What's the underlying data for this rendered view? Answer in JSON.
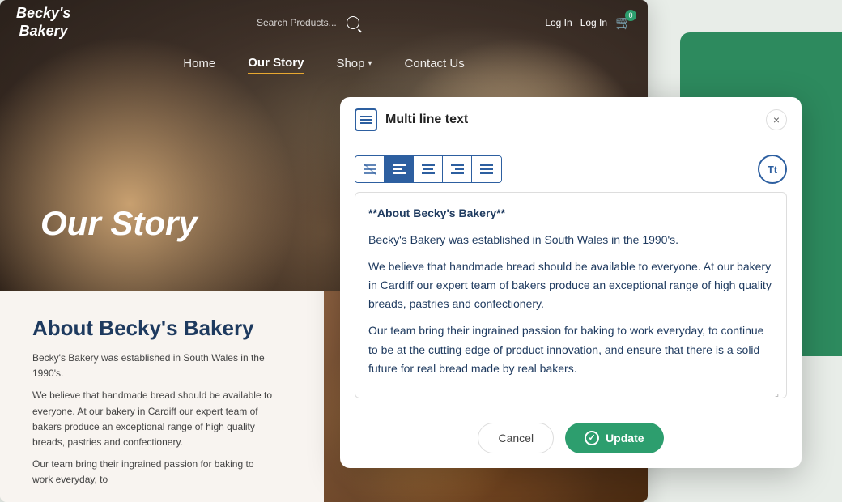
{
  "website": {
    "logo": "Becky's\nBakery",
    "search_placeholder": "Search Products...",
    "login_label": "Log In",
    "cart_count": "0",
    "nav_items": [
      {
        "label": "Home",
        "active": false
      },
      {
        "label": "Our Story",
        "active": true
      },
      {
        "label": "Shop",
        "active": false,
        "has_dropdown": true
      },
      {
        "label": "Contact Us",
        "active": false
      }
    ],
    "page_title": "Our Story",
    "content_heading": "About Becky's Bakery",
    "content_para1": "Becky's Bakery was established in South Wales in the 1990's.",
    "content_para2": "We believe that handmade bread should be available to everyone. At our bakery in Cardiff our expert team of bakers produce an exceptional range of high quality breads, pastries and confectionery.",
    "content_para3": "Our team bring their ingrained passion for baking to work everyday, to"
  },
  "modal": {
    "title": "Multi line text",
    "close_label": "×",
    "icon_label": "≡",
    "format_buttons": [
      {
        "id": "align-left-strikethrough",
        "label": "≡̶",
        "active": false
      },
      {
        "id": "align-left",
        "label": "≡",
        "active": true
      },
      {
        "id": "align-center",
        "label": "≡",
        "active": false
      },
      {
        "id": "align-right",
        "label": "≡",
        "active": false
      },
      {
        "id": "align-justify",
        "label": "≡",
        "active": false
      }
    ],
    "font-size-label": "Tt",
    "text_line1": "**About Becky's Bakery**",
    "text_line2": "Becky's Bakery was established in South Wales in the 1990's.",
    "text_line3": "We believe that handmade bread should be available to everyone. At our bakery in Cardiff our expert team of bakers produce an exceptional range of high quality breads, pastries and confectionery.",
    "text_line4": "Our team bring their ingrained passion for baking to work everyday, to continue to be at the cutting edge of product innovation, and ensure that there is a solid future for real bread made by real bakers.",
    "cancel_label": "Cancel",
    "update_label": "Update"
  },
  "colors": {
    "primary_blue": "#1e3a5f",
    "accent_orange": "#e8a830",
    "btn_green": "#2d9e6e",
    "toolbar_blue": "#2d5fa0",
    "green_bg": "#2d8a5e"
  }
}
